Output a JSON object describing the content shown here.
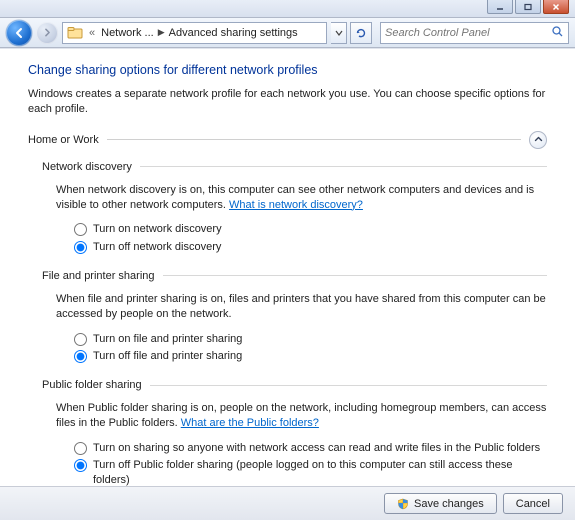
{
  "breadcrumb": {
    "item1": "Network ...",
    "item2": "Advanced sharing settings"
  },
  "search": {
    "placeholder": "Search Control Panel"
  },
  "page": {
    "title": "Change sharing options for different network profiles",
    "desc": "Windows creates a separate network profile for each network you use. You can choose specific options for each profile."
  },
  "profile": {
    "label": "Home or Work"
  },
  "sections": {
    "discovery": {
      "label": "Network discovery",
      "desc": "When network discovery is on, this computer can see other network computers and devices and is visible to other network computers. ",
      "help": "What is network discovery?",
      "opt_on": "Turn on network discovery",
      "opt_off": "Turn off network discovery"
    },
    "fileprint": {
      "label": "File and printer sharing",
      "desc": "When file and printer sharing is on, files and printers that you have shared from this computer can be accessed by people on the network.",
      "opt_on": "Turn on file and printer sharing",
      "opt_off": "Turn off file and printer sharing"
    },
    "publicfolder": {
      "label": "Public folder sharing",
      "desc": "When Public folder sharing is on, people on the network, including homegroup members, can access files in the Public folders. ",
      "help": "What are the Public folders?",
      "opt_on": "Turn on sharing so anyone with network access can read and write files in the Public folders",
      "opt_off": "Turn off Public folder sharing (people logged on to this computer can still access these folders)"
    }
  },
  "footer": {
    "save": "Save changes",
    "cancel": "Cancel"
  }
}
